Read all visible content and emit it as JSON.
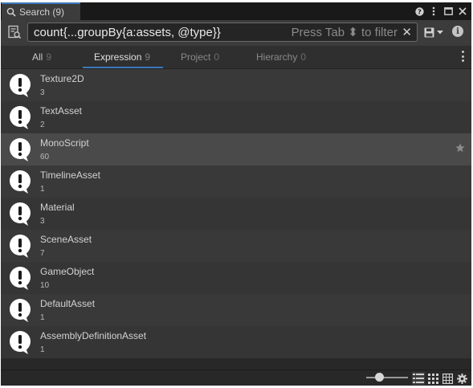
{
  "window": {
    "tab_title": "Search (9)",
    "buttons": [
      "help",
      "more",
      "maximize",
      "close"
    ]
  },
  "search": {
    "query": "count{...groupBy{a:assets, @type}}",
    "hint": "Press Tab ⬍ to filter",
    "clear_label": "✕"
  },
  "provider_tabs": [
    {
      "label": "All",
      "count": "9"
    },
    {
      "label": "Expression",
      "count": "9"
    },
    {
      "label": "Project",
      "count": "0"
    },
    {
      "label": "Hierarchy",
      "count": "0"
    }
  ],
  "active_tab": "Expression",
  "results": [
    {
      "label": "Texture2D",
      "description": "3"
    },
    {
      "label": "TextAsset",
      "description": "2"
    },
    {
      "label": "MonoScript",
      "description": "60"
    },
    {
      "label": "TimelineAsset",
      "description": "1"
    },
    {
      "label": "Material",
      "description": "3"
    },
    {
      "label": "SceneAsset",
      "description": "7"
    },
    {
      "label": "GameObject",
      "description": "10"
    },
    {
      "label": "DefaultAsset",
      "description": "1"
    },
    {
      "label": "AssemblyDefinitionAsset",
      "description": "1"
    }
  ],
  "selected_result": "MonoScript",
  "status": {
    "item_size_slider": 0.3,
    "view_modes": [
      "list-view",
      "grid-view",
      "table-view"
    ],
    "active_view": "list-view"
  },
  "colors": {
    "accent": "#3a79bb",
    "background": "#282828",
    "row_selected": "#4a4a4a"
  }
}
